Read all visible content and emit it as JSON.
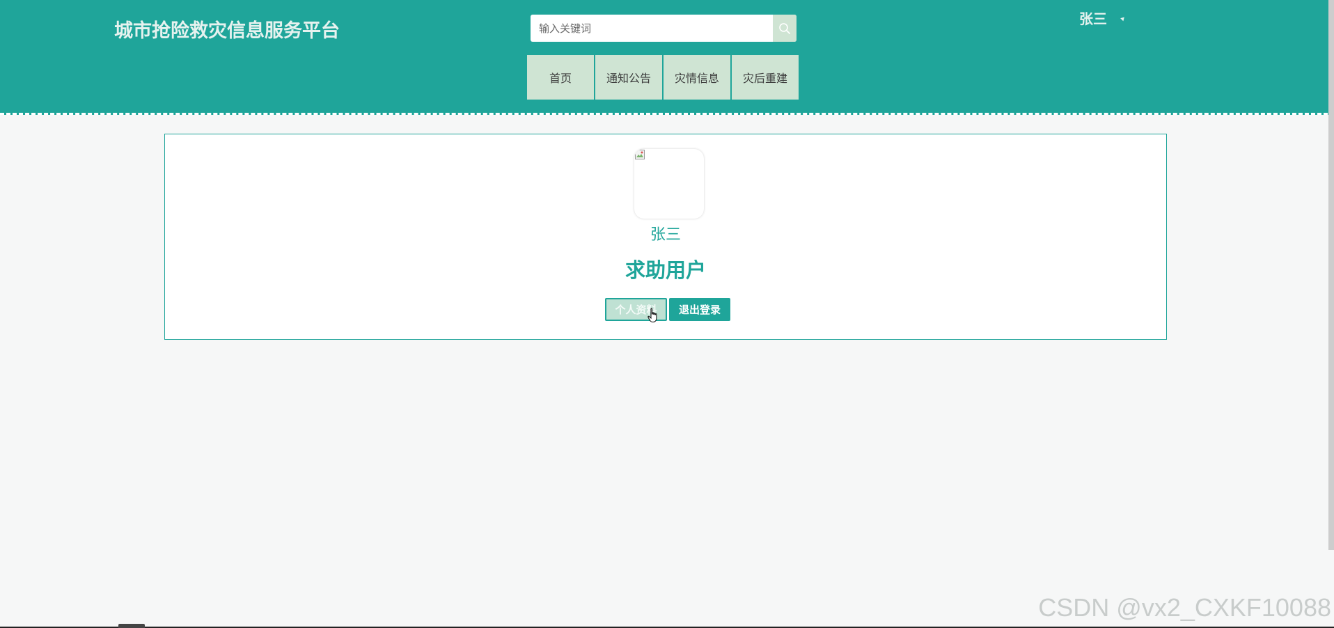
{
  "header": {
    "site_title": "城市抢险救灾信息服务平台",
    "search": {
      "placeholder": "输入关键词",
      "value": ""
    },
    "nav": [
      {
        "label": "首页"
      },
      {
        "label": "通知公告"
      },
      {
        "label": "灾情信息"
      },
      {
        "label": "灾后重建"
      }
    ],
    "user": {
      "name": "张三"
    }
  },
  "profile_card": {
    "name": "张三",
    "role": "求助用户",
    "buttons": {
      "profile": "个人资料",
      "logout": "退出登录"
    }
  },
  "watermark": "CSDN @vx2_CXKF10088",
  "colors": {
    "primary": "#1fa59a",
    "nav_bg": "#cfe4d3",
    "page_bg": "#f6f7f7"
  },
  "icons": {
    "search": "search-icon",
    "user_caret": "caret-icon",
    "avatar": "broken-image-icon",
    "cursor": "hand-pointer-icon"
  }
}
